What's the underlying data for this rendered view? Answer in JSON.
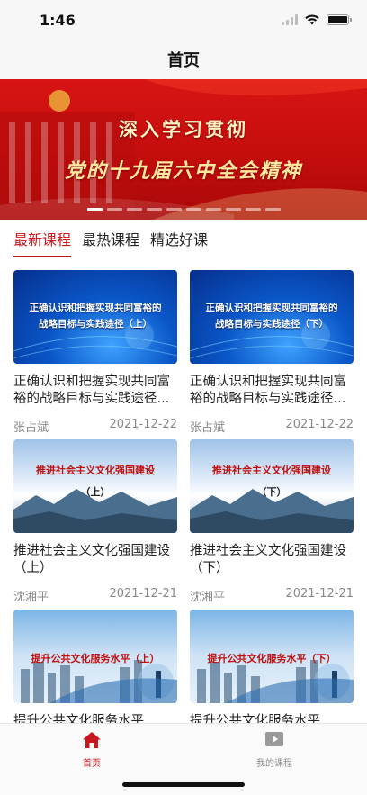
{
  "status_bar": {
    "time": "1:46"
  },
  "nav": {
    "title": "首页"
  },
  "banner": {
    "line1": "深入学习贯彻",
    "line2": "党的十九届六中全会精神",
    "dot_count": 10,
    "active_dot": 0
  },
  "tabs": [
    {
      "label": "最新课程",
      "active": true
    },
    {
      "label": "最热课程",
      "active": false
    },
    {
      "label": "精选好课",
      "active": false
    }
  ],
  "courses": [
    {
      "thumb_text_1": "正确认识和把握实现共同富裕的",
      "thumb_text_2": "战略目标与实践途径（上）",
      "title": "正确认识和把握实现共同富裕的战略目标与实践途径...",
      "author": "张占斌",
      "date": "2021-12-22"
    },
    {
      "thumb_text_1": "正确认识和把握实现共同富裕的",
      "thumb_text_2": "战略目标与实践途径（下）",
      "title": "正确认识和把握实现共同富裕的战略目标与实践途径...",
      "author": "张占斌",
      "date": "2021-12-22"
    },
    {
      "thumb_text_1": "推进社会主义文化强国建设",
      "thumb_text_2": "（上）",
      "title": "推进社会主义文化强国建设（上）",
      "author": "沈湘平",
      "date": "2021-12-21"
    },
    {
      "thumb_text_1": "推进社会主义文化强国建设",
      "thumb_text_2": "（下）",
      "title": "推进社会主义文化强国建设（下）",
      "author": "沈湘平",
      "date": "2021-12-21"
    },
    {
      "thumb_text_1": "提升公共文化服务水平（上）",
      "thumb_text_2": "",
      "title": "提升公共文化服务水平",
      "author": "",
      "date": ""
    },
    {
      "thumb_text_1": "提升公共文化服务水平（下）",
      "thumb_text_2": "",
      "title": "提升公共文化服务水平",
      "author": "",
      "date": ""
    }
  ],
  "tab_bar": {
    "home_label": "首页",
    "my_courses_label": "我的课程"
  },
  "colors": {
    "accent": "#c8161d",
    "banner_red": "#d81414"
  },
  "icons": {
    "home": "home-icon",
    "my_courses": "video-play-icon"
  }
}
